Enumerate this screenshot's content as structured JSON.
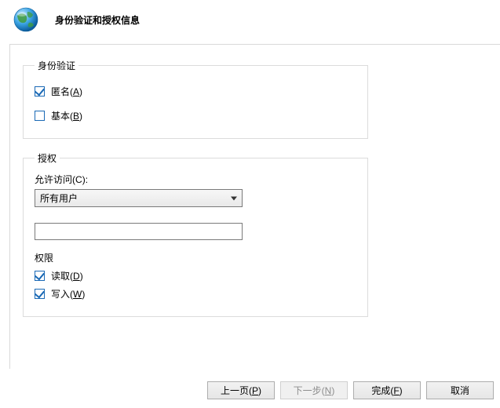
{
  "header": {
    "title": "身份验证和授权信息",
    "icon_name": "globe-icon"
  },
  "groups": {
    "auth": {
      "legend": "身份验证",
      "anonymous": {
        "label": "匿名",
        "accel": "A",
        "checked": true
      },
      "basic": {
        "label": "基本",
        "accel": "B",
        "checked": false
      }
    },
    "authorization": {
      "legend": "授权",
      "allow_access_label": "允许访问",
      "allow_access_accel": "C",
      "allow_access_colon": ":",
      "allow_access_selected": "所有用户",
      "specify_value": "",
      "permissions_heading": "权限",
      "read": {
        "label": "读取",
        "accel": "D",
        "checked": true
      },
      "write": {
        "label": "写入",
        "accel": "W",
        "checked": true
      }
    }
  },
  "footer": {
    "prev": {
      "label": "上一页",
      "accel": "P",
      "enabled": true
    },
    "next": {
      "label": "下一步",
      "accel": "N",
      "enabled": false
    },
    "finish": {
      "label": "完成",
      "accel": "F",
      "enabled": true
    },
    "cancel": {
      "label": "取消",
      "accel": "",
      "enabled": true
    }
  }
}
